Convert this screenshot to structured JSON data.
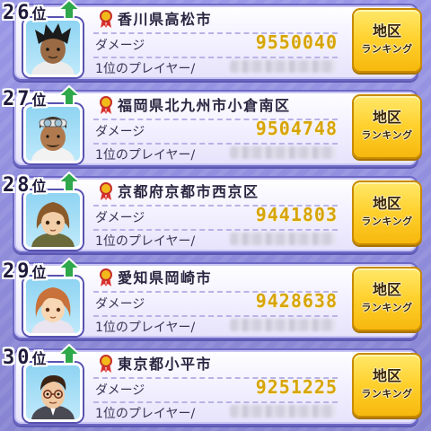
{
  "rank_suffix": "位",
  "damage_label": "ダメージ",
  "first_player_label": "1位のプレイヤー/",
  "button": {
    "line1": "地区",
    "line2": "ランキング"
  },
  "colors": {
    "card_border": "#6d69c6",
    "damage_value": "#d7a508",
    "button": "#ffd02c",
    "rank_up_arrow": "#2ea84a"
  },
  "entries": [
    {
      "rank": "26",
      "region": "香川県高松市",
      "damage": "9550040",
      "trend": "up-arrow-icon"
    },
    {
      "rank": "27",
      "region": "福岡県北九州市小倉南区",
      "damage": "9504748",
      "trend": "up-arrow-icon"
    },
    {
      "rank": "28",
      "region": "京都府京都市西京区",
      "damage": "9441803",
      "trend": "up-arrow-icon"
    },
    {
      "rank": "29",
      "region": "愛知県岡崎市",
      "damage": "9428638",
      "trend": "up-arrow-icon"
    },
    {
      "rank": "30",
      "region": "東京都小平市",
      "damage": "9251225",
      "trend": "up-arrow-icon"
    }
  ]
}
